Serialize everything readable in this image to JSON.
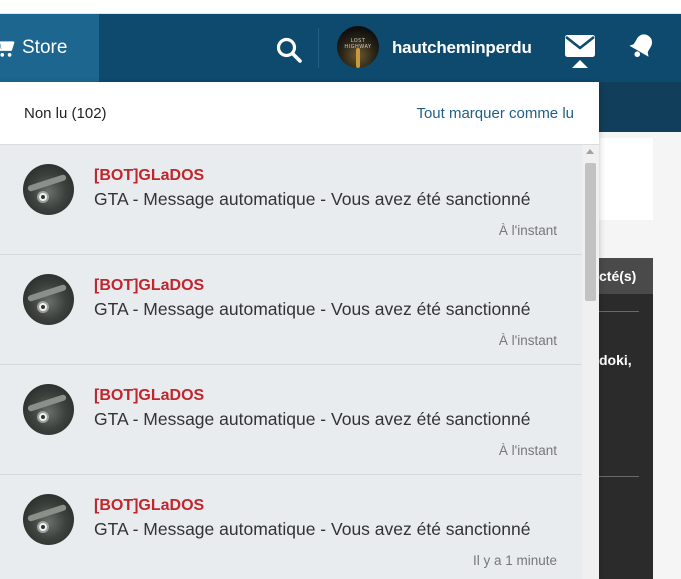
{
  "navbar": {
    "store_label": "Store",
    "username": "hautcheminperdu",
    "avatar_text": "LOST HIGHWAY",
    "icons": {
      "store": "shopping-cart-icon",
      "search": "search-icon",
      "messages": "envelope-icon",
      "alerts": "bell-icon"
    }
  },
  "notifications_panel": {
    "unread_label": "Non lu (102)",
    "mark_all_label": "Tout marquer comme lu",
    "items": [
      {
        "sender": "[BOT]GLaDOS",
        "message": "GTA - Message automatique - Vous avez été sanctionné",
        "time": "À l'instant"
      },
      {
        "sender": "[BOT]GLaDOS",
        "message": "GTA - Message automatique - Vous avez été sanctionné",
        "time": "À l'instant"
      },
      {
        "sender": "[BOT]GLaDOS",
        "message": "GTA - Message automatique - Vous avez été sanctionné",
        "time": "À l'instant"
      },
      {
        "sender": "[BOT]GLaDOS",
        "message": "GTA - Message automatique - Vous avez été sanctionné",
        "time": "Il y a 1 minute"
      }
    ]
  },
  "background_page": {
    "panel_header": "cté(s)",
    "panel_text": "doki,"
  },
  "colors": {
    "navbar": "#0d4a6e",
    "store_button": "#1d6690",
    "sender": "#c0262c",
    "link": "#1f5f86",
    "item_background": "#e8ecef"
  }
}
